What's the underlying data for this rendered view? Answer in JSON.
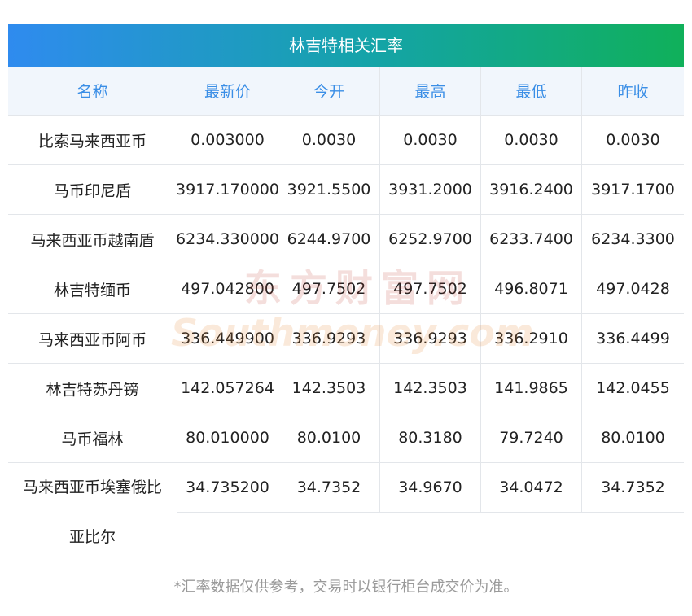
{
  "title": "林吉特相关汇率",
  "headers": [
    "名称",
    "最新价",
    "今开",
    "最高",
    "最低",
    "昨收"
  ],
  "rows": [
    {
      "name": "比索马来西亚币",
      "vals": [
        "0.003000",
        "0.0030",
        "0.0030",
        "0.0030",
        "0.0030"
      ]
    },
    {
      "name": "马币印尼盾",
      "vals": [
        "3917.170000",
        "3921.5500",
        "3931.2000",
        "3916.2400",
        "3917.1700"
      ]
    },
    {
      "name": "马来西亚币越南盾",
      "vals": [
        "6234.330000",
        "6244.9700",
        "6252.9700",
        "6233.7400",
        "6234.3300"
      ]
    },
    {
      "name": "林吉特缅币",
      "vals": [
        "497.042800",
        "497.7502",
        "497.7502",
        "496.8071",
        "497.0428"
      ]
    },
    {
      "name": "马来西亚币阿币",
      "vals": [
        "336.449900",
        "336.9293",
        "336.9293",
        "336.2910",
        "336.4499"
      ]
    },
    {
      "name": "林吉特苏丹镑",
      "vals": [
        "142.057264",
        "142.3503",
        "142.3503",
        "141.9865",
        "142.0455"
      ]
    },
    {
      "name": "马币福林",
      "vals": [
        "80.010000",
        "80.0100",
        "80.3180",
        "79.7240",
        "80.0100"
      ]
    },
    {
      "name": "马来西亚币埃塞俄比亚比尔",
      "name_line1": "马来西亚币埃塞俄比",
      "name_line2": "亚比尔",
      "vals": [
        "34.735200",
        "34.7352",
        "34.9670",
        "34.0472",
        "34.7352"
      ]
    }
  ],
  "footnote": "*汇率数据仅供参考，交易时以银行柜台成交价为准。",
  "watermark": {
    "cn": "东方财富网",
    "en": "Southmoney.com"
  },
  "colors": {
    "header_text": "#3a8ee6",
    "header_bg": "#f1f6fc",
    "title_start": "#2f8bef",
    "title_end": "#10b05a"
  }
}
